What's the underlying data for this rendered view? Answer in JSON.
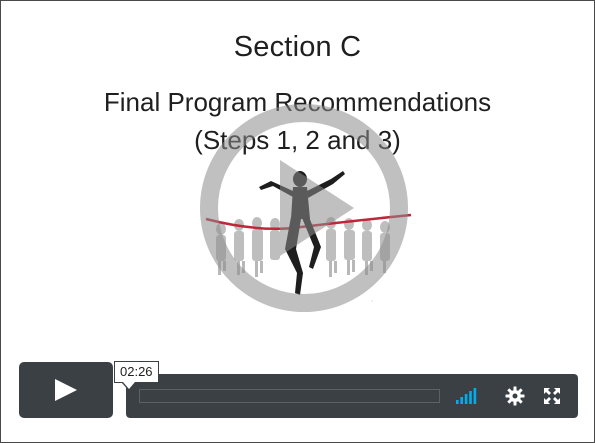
{
  "slide": {
    "title": "Section C",
    "subtitle_line1": "Final Program Recommendations",
    "subtitle_line2": "(Steps 1, 2 and 3)"
  },
  "player": {
    "time_tooltip": "02:26",
    "progress_fraction": 0.0,
    "volume_level_bars": 5,
    "accent_color": "#00adef",
    "bar_color": "#3b4045",
    "icons": {
      "play": "play-icon",
      "volume": "volume-bars-icon",
      "settings": "gear-icon",
      "fullscreen": "fullscreen-icon",
      "overlay": "big-play-icon"
    }
  }
}
